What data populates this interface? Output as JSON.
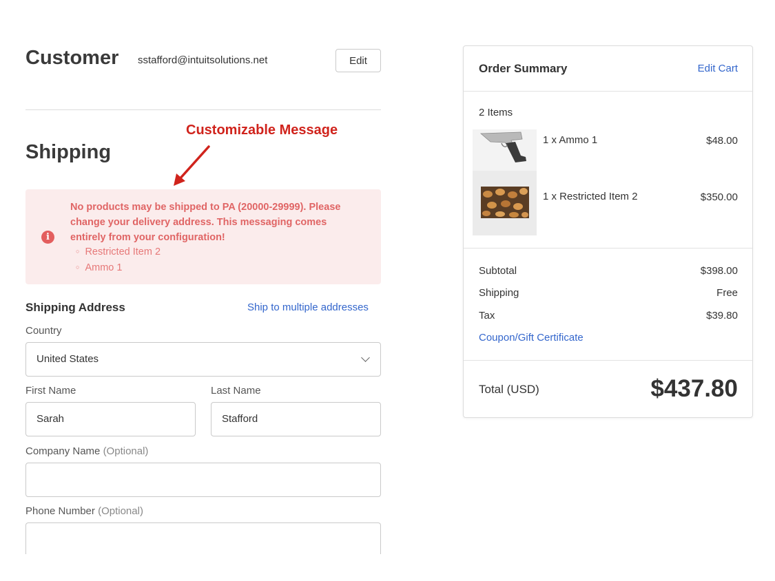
{
  "customer": {
    "title": "Customer",
    "email": "sstafford@intuitsolutions.net",
    "edit_label": "Edit"
  },
  "annotation": {
    "text": "Customizable Message",
    "color": "#d0231c"
  },
  "shipping": {
    "title": "Shipping",
    "alert": {
      "message": "No products may be shipped to PA (20000-29999). Please change your delivery address. This messaging comes entirely from your configuration!",
      "items": [
        "Restricted Item 2",
        "Ammo 1"
      ],
      "icon": "info-icon",
      "color": "#e06565"
    },
    "address_title": "Shipping Address",
    "multi_link": "Ship to multiple addresses",
    "country_label": "Country",
    "country_value": "United States",
    "first_name_label": "First Name",
    "first_name_value": "Sarah",
    "last_name_label": "Last Name",
    "last_name_value": "Stafford",
    "company_label": "Company Name",
    "company_optional": "(Optional)",
    "company_value": "",
    "phone_label": "Phone Number",
    "phone_optional": "(Optional)",
    "phone_value": ""
  },
  "summary": {
    "title": "Order Summary",
    "edit_cart": "Edit Cart",
    "items_count": "2 Items",
    "items": [
      {
        "name": "1 x Ammo 1",
        "price": "$48.00",
        "image": "pistol-image"
      },
      {
        "name": "1 x Restricted Item 2",
        "price": "$350.00",
        "image": "ammunition-image"
      }
    ],
    "subtotal_label": "Subtotal",
    "subtotal_value": "$398.00",
    "shipping_label": "Shipping",
    "shipping_value": "Free",
    "tax_label": "Tax",
    "tax_value": "$39.80",
    "coupon": "Coupon/Gift Certificate",
    "total_label": "Total (USD)",
    "total_value": "$437.80"
  },
  "colors": {
    "link": "#3366cc",
    "alert_bg": "#fbecec"
  }
}
